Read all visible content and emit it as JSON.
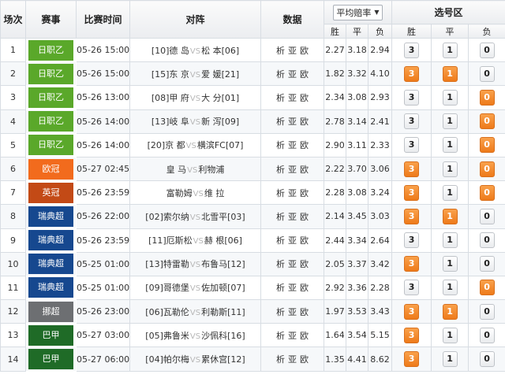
{
  "header": {
    "col_no": "场次",
    "col_league": "赛事",
    "col_time": "比赛时间",
    "col_match": "对阵",
    "col_stats": "数据",
    "odds_select": "平均赔率",
    "odds_sub": [
      "胜",
      "平",
      "负"
    ],
    "pick_title": "选号区",
    "pick_sub": [
      "胜",
      "平",
      "负"
    ]
  },
  "stats_labels": [
    "析",
    "亚",
    "欧"
  ],
  "vs_label": "VS",
  "colors": {
    "league_green": "#5aa82a",
    "league_orange": "#f26b1d",
    "league_brown": "#c34a16",
    "league_blue": "#16488f",
    "league_gray": "#6d6f72",
    "league_darkgreen": "#1f6b27",
    "pick_selected": "#ee7a1a"
  },
  "rows": [
    {
      "no": "1",
      "league": "日职乙",
      "color": "c-green",
      "time": "05-26 15:00",
      "home": "[10]德 岛",
      "away": "松 本[06]",
      "odds": [
        "2.27",
        "3.18",
        "2.94"
      ],
      "picks": [
        "3",
        "1",
        "0"
      ],
      "selected": [
        false,
        false,
        false
      ]
    },
    {
      "no": "2",
      "league": "日职乙",
      "color": "c-green",
      "time": "05-26 15:00",
      "home": "[15]东 京",
      "away": "爱 媛[21]",
      "odds": [
        "1.82",
        "3.32",
        "4.10"
      ],
      "picks": [
        "3",
        "1",
        "0"
      ],
      "selected": [
        true,
        true,
        false
      ]
    },
    {
      "no": "3",
      "league": "日职乙",
      "color": "c-green",
      "time": "05-26 13:00",
      "home": "[08]甲 府",
      "away": "大 分[01]",
      "odds": [
        "2.34",
        "3.08",
        "2.93"
      ],
      "picks": [
        "3",
        "1",
        "0"
      ],
      "selected": [
        false,
        false,
        true
      ]
    },
    {
      "no": "4",
      "league": "日职乙",
      "color": "c-green",
      "time": "05-26 14:00",
      "home": "[13]岐 阜",
      "away": "新 泻[09]",
      "odds": [
        "2.78",
        "3.14",
        "2.41"
      ],
      "picks": [
        "3",
        "1",
        "0"
      ],
      "selected": [
        false,
        false,
        true
      ]
    },
    {
      "no": "5",
      "league": "日职乙",
      "color": "c-green",
      "time": "05-26 14:00",
      "home": "[20]京 都",
      "away": "横滨FC[07]",
      "odds": [
        "2.90",
        "3.11",
        "2.33"
      ],
      "picks": [
        "3",
        "1",
        "0"
      ],
      "selected": [
        false,
        false,
        true
      ]
    },
    {
      "no": "6",
      "league": "欧冠",
      "color": "c-orange",
      "time": "05-27 02:45",
      "home": "皇 马",
      "away": "利物浦",
      "odds": [
        "2.22",
        "3.70",
        "3.06"
      ],
      "picks": [
        "3",
        "1",
        "0"
      ],
      "selected": [
        true,
        false,
        true
      ]
    },
    {
      "no": "7",
      "league": "英冠",
      "color": "c-brown",
      "time": "05-26 23:59",
      "home": "富勒姆",
      "away": "维 拉",
      "odds": [
        "2.28",
        "3.08",
        "3.24"
      ],
      "picks": [
        "3",
        "1",
        "0"
      ],
      "selected": [
        true,
        false,
        true
      ]
    },
    {
      "no": "8",
      "league": "瑞典超",
      "color": "c-blue",
      "time": "05-26 22:00",
      "home": "[02]索尔纳",
      "away": "北雪平[03]",
      "odds": [
        "2.14",
        "3.45",
        "3.03"
      ],
      "picks": [
        "3",
        "1",
        "0"
      ],
      "selected": [
        true,
        true,
        false
      ]
    },
    {
      "no": "9",
      "league": "瑞典超",
      "color": "c-blue",
      "time": "05-26 23:59",
      "home": "[11]厄斯松",
      "away": "赫 根[06]",
      "odds": [
        "2.44",
        "3.34",
        "2.64"
      ],
      "picks": [
        "3",
        "1",
        "0"
      ],
      "selected": [
        false,
        false,
        false
      ]
    },
    {
      "no": "10",
      "league": "瑞典超",
      "color": "c-blue",
      "time": "05-25 01:00",
      "home": "[13]特雷勒",
      "away": "布鲁马[12]",
      "odds": [
        "2.05",
        "3.37",
        "3.42"
      ],
      "picks": [
        "3",
        "1",
        "0"
      ],
      "selected": [
        true,
        false,
        false
      ]
    },
    {
      "no": "11",
      "league": "瑞典超",
      "color": "c-blue",
      "time": "05-25 01:00",
      "home": "[09]哥德堡",
      "away": "佐加顿[07]",
      "odds": [
        "2.92",
        "3.36",
        "2.28"
      ],
      "picks": [
        "3",
        "1",
        "0"
      ],
      "selected": [
        false,
        false,
        true
      ]
    },
    {
      "no": "12",
      "league": "挪超",
      "color": "c-gray",
      "time": "05-26 23:00",
      "home": "[06]瓦勒伦",
      "away": "利勒斯[11]",
      "odds": [
        "1.97",
        "3.53",
        "3.43"
      ],
      "picks": [
        "3",
        "1",
        "0"
      ],
      "selected": [
        true,
        true,
        false
      ]
    },
    {
      "no": "13",
      "league": "巴甲",
      "color": "c-dgreen",
      "time": "05-27 03:00",
      "home": "[05]弗鲁米",
      "away": "沙佩科[16]",
      "odds": [
        "1.64",
        "3.54",
        "5.15"
      ],
      "picks": [
        "3",
        "1",
        "0"
      ],
      "selected": [
        true,
        false,
        false
      ]
    },
    {
      "no": "14",
      "league": "巴甲",
      "color": "c-dgreen",
      "time": "05-27 06:00",
      "home": "[04]帕尔梅",
      "away": "累休宫[12]",
      "odds": [
        "1.35",
        "4.41",
        "8.62"
      ],
      "picks": [
        "3",
        "1",
        "0"
      ],
      "selected": [
        true,
        false,
        false
      ]
    }
  ]
}
